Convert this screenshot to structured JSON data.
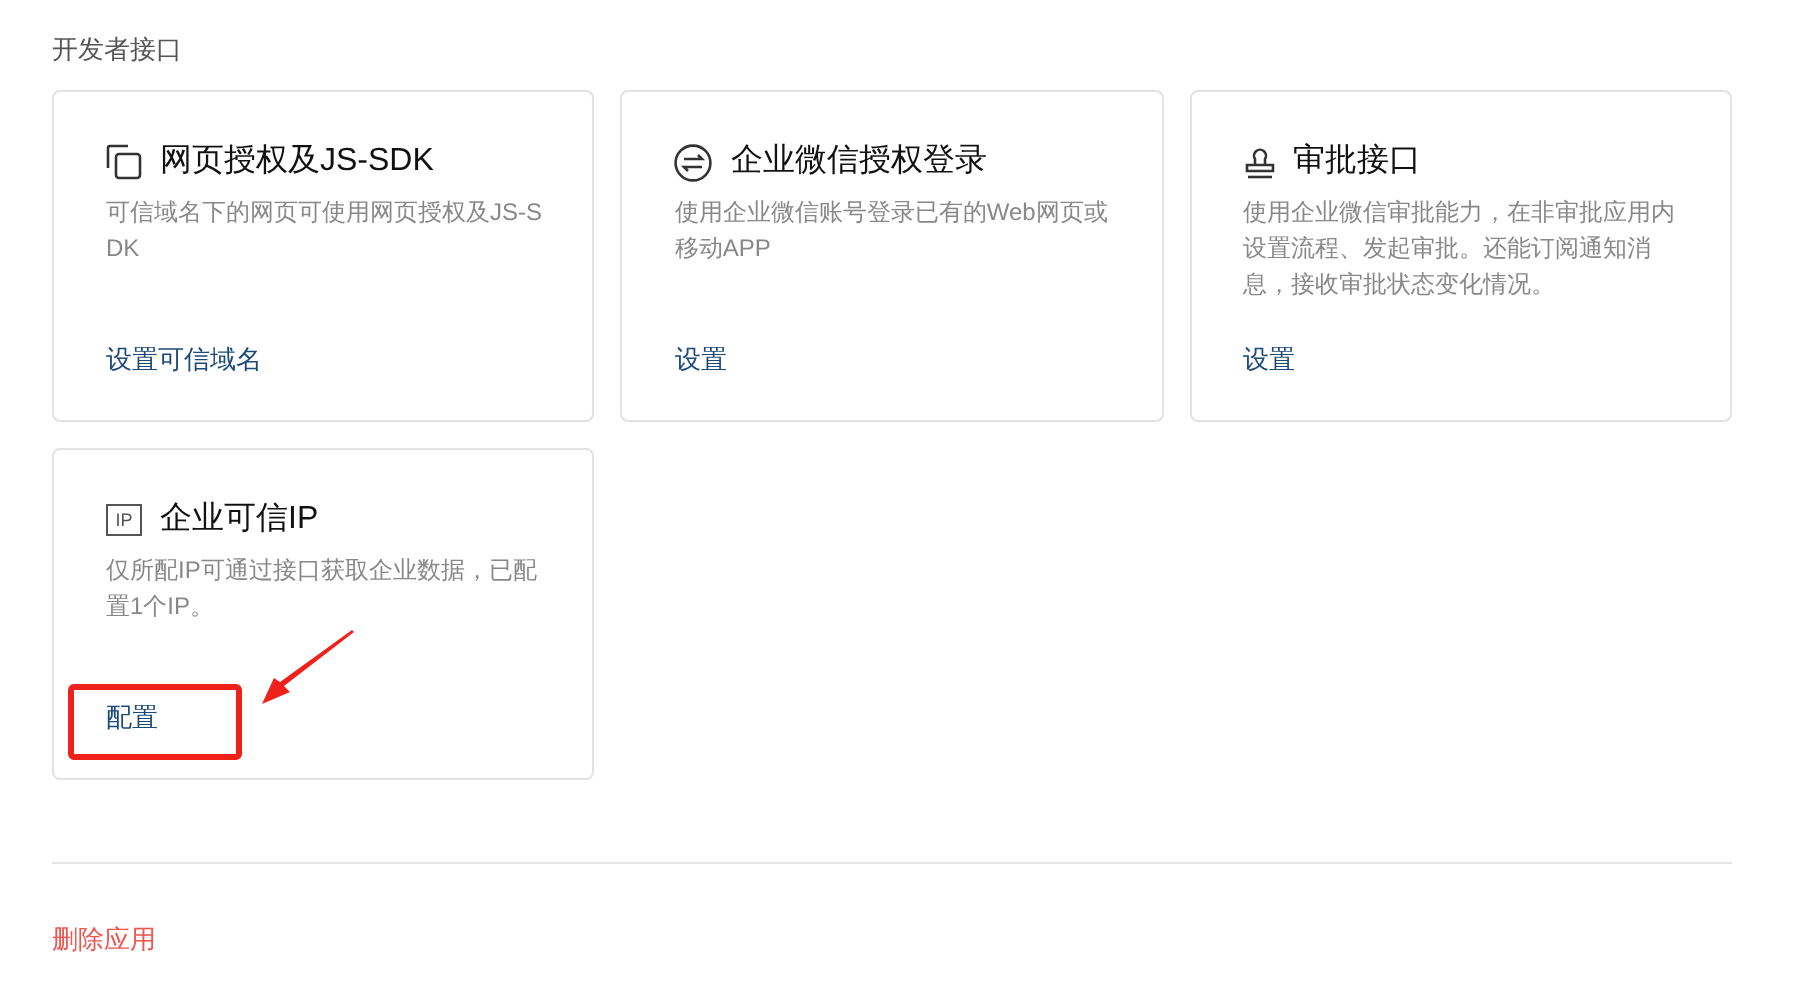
{
  "section_title": "开发者接口",
  "cards": [
    {
      "kind": "pages",
      "title": "网页授权及JS-SDK",
      "description": "可信域名下的网页可使用网页授权及JS-SDK",
      "link": "设置可信域名",
      "highlighted": false
    },
    {
      "kind": "exchange",
      "title": "企业微信授权登录",
      "description": "使用企业微信账号登录已有的Web网页或移动APP",
      "link": "设置",
      "highlighted": false
    },
    {
      "kind": "stamp",
      "title": "审批接口",
      "description": "使用企业微信审批能力，在非审批应用内设置流程、发起审批。还能订阅通知消息，接收审批状态变化情况。",
      "link": "设置",
      "highlighted": false
    },
    {
      "kind": "ip",
      "icon_label": "IP",
      "title": "企业可信IP",
      "description": "仅所配IP可通过接口获取企业数据，已配置1个IP。",
      "link": "配置",
      "highlighted": true
    }
  ],
  "delete_link": "删除应用"
}
